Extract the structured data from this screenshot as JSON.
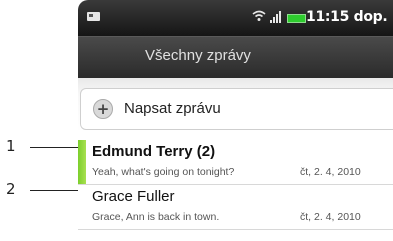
{
  "callouts": [
    "1",
    "2"
  ],
  "status_bar": {
    "time": "11:15 dop.",
    "icons": [
      "sim-card-icon",
      "wifi-icon",
      "signal-icon",
      "battery-icon"
    ]
  },
  "header": {
    "title": "Všechny zprávy"
  },
  "compose": {
    "label": "Napsat zprávu",
    "icon": "plus-icon"
  },
  "messages": [
    {
      "name": "Edmund Terry (2)",
      "preview": "Yeah, what's going on tonight?",
      "date": "čt, 2. 4, 2010",
      "unread": true
    },
    {
      "name": "Grace Fuller",
      "preview": "Grace, Ann is back in town.",
      "date": "čt, 2. 4, 2010",
      "unread": false
    }
  ],
  "colors": {
    "unread_indicator": "#8bd637",
    "title_bar": "#333333"
  }
}
